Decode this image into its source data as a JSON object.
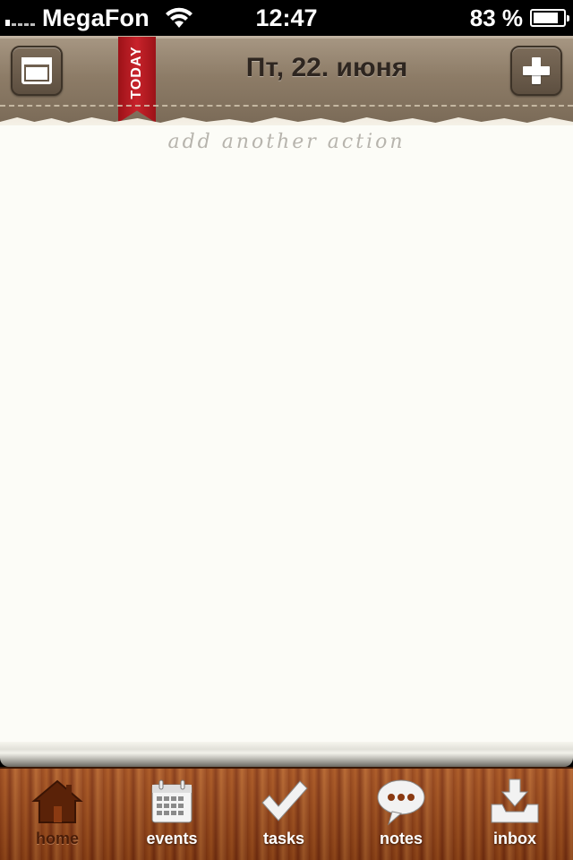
{
  "status_bar": {
    "carrier": "MegaFon",
    "time": "12:47",
    "battery_percent": "83 %",
    "battery_level": 0.83,
    "signal_bars_filled": 1,
    "signal_bars_total": 5
  },
  "header": {
    "date": "Пт, 22. июня",
    "ribbon": "TODAY",
    "left_icon": "calendar-icon",
    "right_icon": "plus-icon",
    "ribbon_color": "#c8232b"
  },
  "main": {
    "placeholder": "add another action"
  },
  "tabbar": {
    "tabs": [
      {
        "label": "home",
        "icon": "home-icon",
        "active": true
      },
      {
        "label": "events",
        "icon": "calendar-icon",
        "active": false
      },
      {
        "label": "tasks",
        "icon": "checkmark-icon",
        "active": false
      },
      {
        "label": "notes",
        "icon": "speech-bubble-icon",
        "active": false
      },
      {
        "label": "inbox",
        "icon": "inbox-download-icon",
        "active": false
      }
    ]
  }
}
